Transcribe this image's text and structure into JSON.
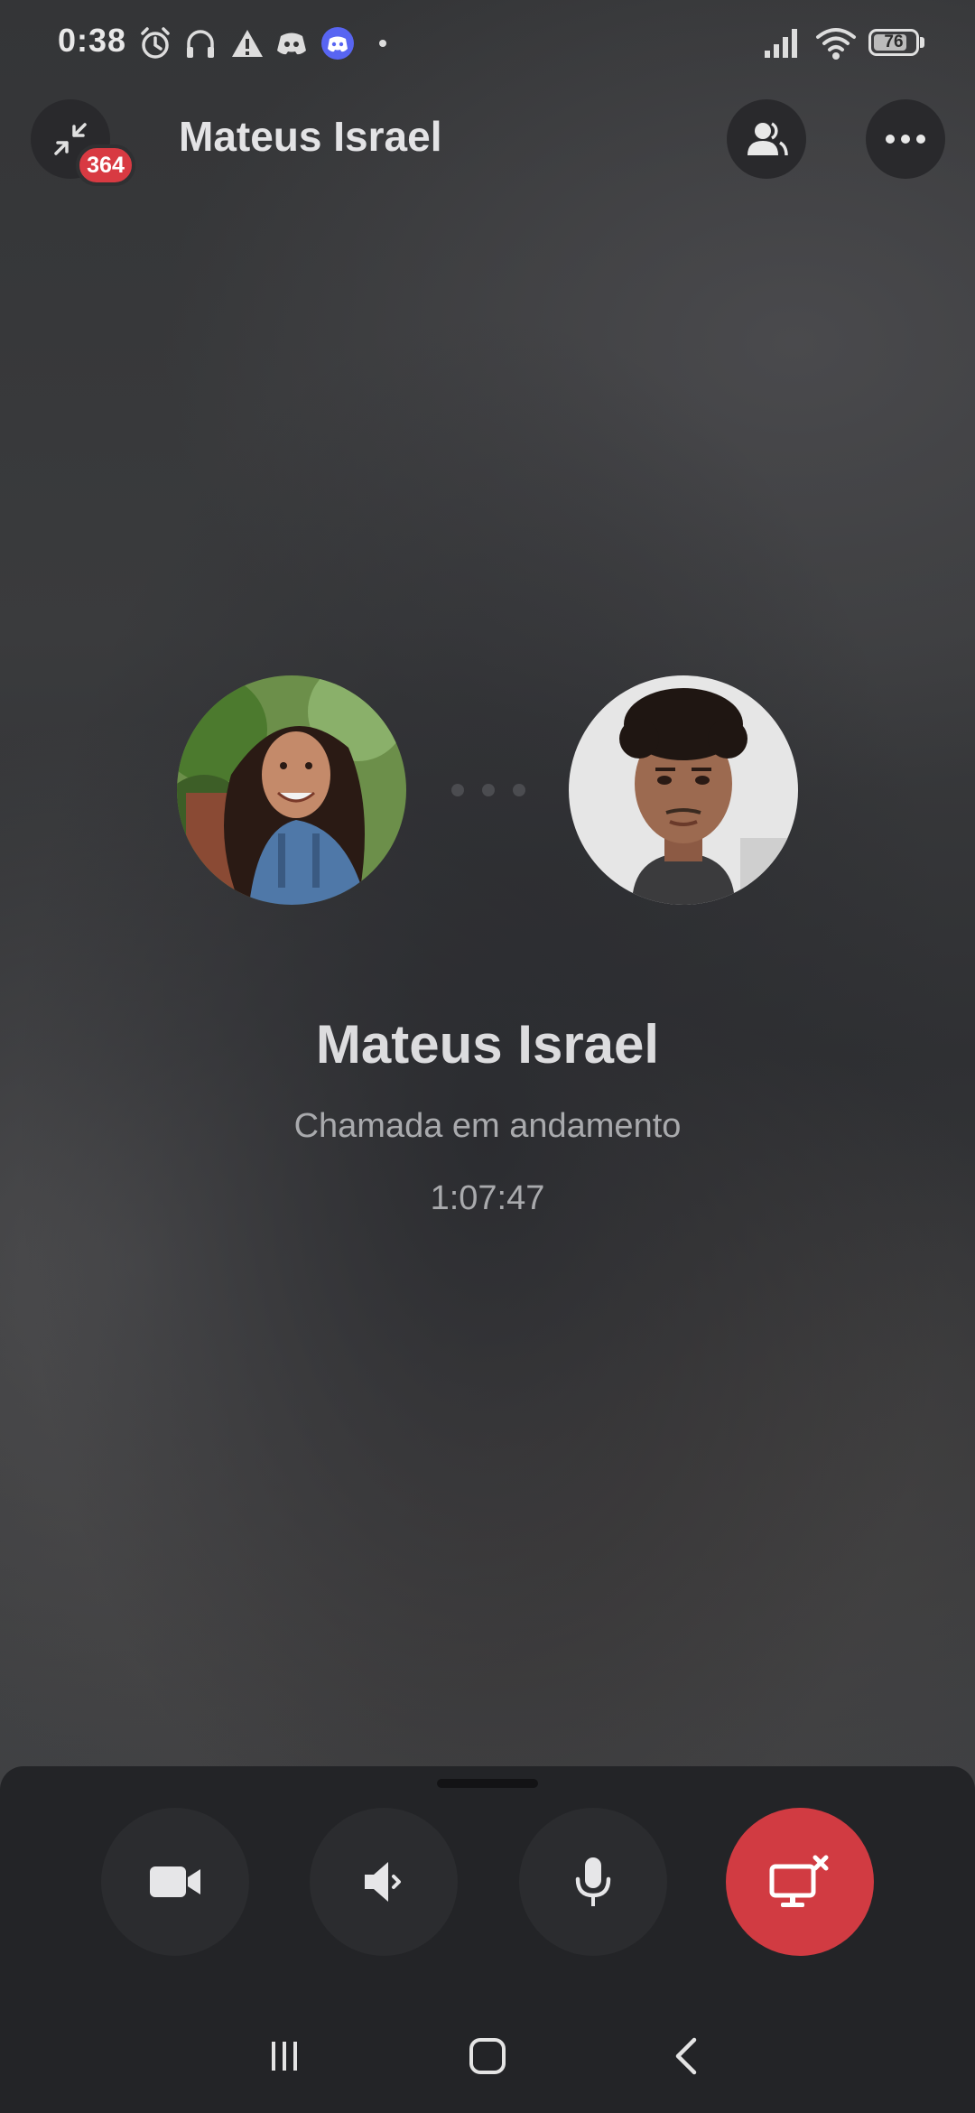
{
  "status_bar": {
    "time": "0:38",
    "icons": [
      "alarm-icon",
      "headset-icon",
      "warning-icon",
      "discord-icon",
      "discord-app-icon",
      "notification-dot",
      "signal-icon",
      "wifi-icon",
      "battery-icon"
    ],
    "battery_level": "76"
  },
  "header": {
    "title": "Mateus Israel",
    "badge_count": "364",
    "buttons": [
      "minimize-icon",
      "participants-icon",
      "more-options-icon"
    ]
  },
  "call": {
    "participants": [
      {
        "avatar": "participant-avatar-woman"
      },
      {
        "avatar": "participant-avatar-man"
      }
    ],
    "name": "Mateus Israel",
    "status": "Chamada em andamento",
    "duration": "1:07:47"
  },
  "controls": [
    "video-camera-icon",
    "speaker-icon",
    "microphone-icon",
    "end-screenshare-icon"
  ],
  "nav": [
    "recents-icon",
    "home-icon",
    "back-icon"
  ],
  "colors": {
    "end_button": "#d13b42",
    "badge": "#d83a42",
    "sheet": "#232427",
    "discord_blurple": "#5865f2"
  }
}
